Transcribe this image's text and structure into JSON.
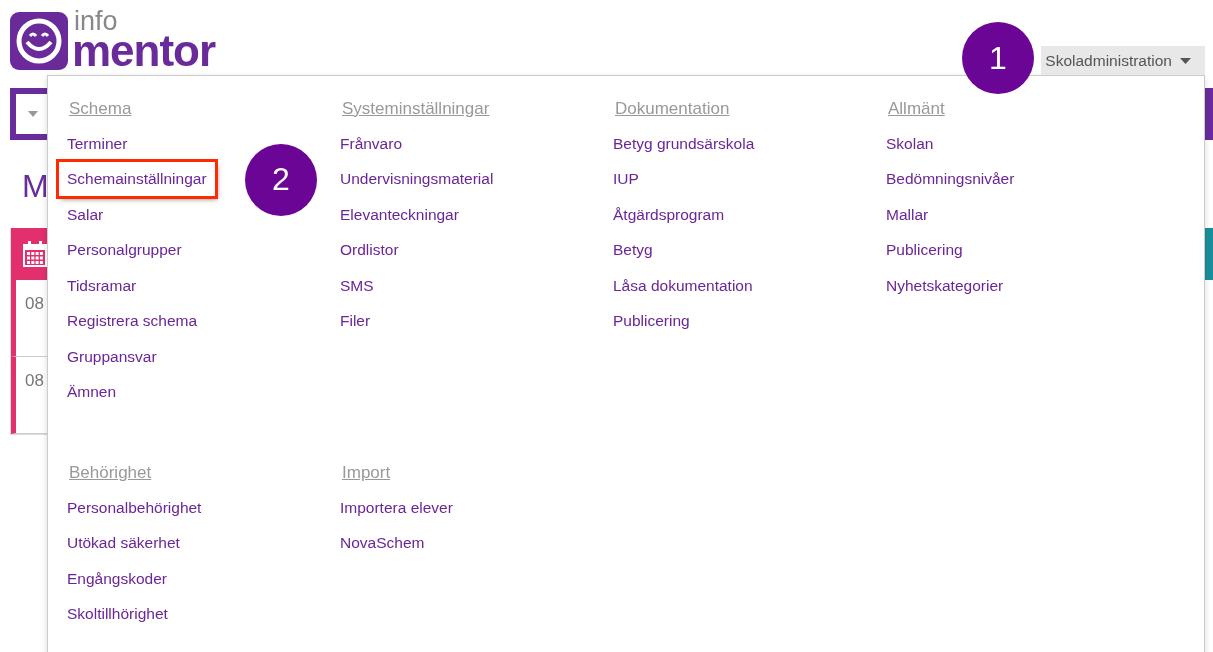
{
  "header": {
    "logo": {
      "top": "info",
      "bottom": "mentor"
    },
    "admin_button": {
      "label": "Skoladministration",
      "open": true
    }
  },
  "background": {
    "heading": "M",
    "times": [
      "08",
      "08"
    ]
  },
  "menu": {
    "sections": [
      {
        "title": "Schema",
        "items": [
          {
            "label": "Terminer",
            "highlighted": false
          },
          {
            "label": "Schemainställningar",
            "highlighted": true
          },
          {
            "label": "Salar",
            "highlighted": false
          },
          {
            "label": "Personalgrupper",
            "highlighted": false
          },
          {
            "label": "Tidsramar",
            "highlighted": false
          },
          {
            "label": "Registrera schema",
            "highlighted": false
          },
          {
            "label": "Gruppansvar",
            "highlighted": false
          },
          {
            "label": "Ämnen",
            "highlighted": false
          }
        ]
      },
      {
        "title": "Systeminställningar",
        "items": [
          {
            "label": "Frånvaro",
            "highlighted": false
          },
          {
            "label": "Undervisningsmaterial",
            "highlighted": false
          },
          {
            "label": "Elevanteckningar",
            "highlighted": false
          },
          {
            "label": "Ordlistor",
            "highlighted": false
          },
          {
            "label": "SMS",
            "highlighted": false
          },
          {
            "label": "Filer",
            "highlighted": false
          }
        ]
      },
      {
        "title": "Dokumentation",
        "items": [
          {
            "label": "Betyg grundsärskola",
            "highlighted": false
          },
          {
            "label": "IUP",
            "highlighted": false
          },
          {
            "label": "Åtgärdsprogram",
            "highlighted": false
          },
          {
            "label": "Betyg",
            "highlighted": false
          },
          {
            "label": "Låsa dokumentation",
            "highlighted": false
          },
          {
            "label": "Publicering",
            "highlighted": false
          }
        ]
      },
      {
        "title": "Allmänt",
        "items": [
          {
            "label": "Skolan",
            "highlighted": false
          },
          {
            "label": "Bedömningsnivåer",
            "highlighted": false
          },
          {
            "label": "Mallar",
            "highlighted": false
          },
          {
            "label": "Publicering",
            "highlighted": false
          },
          {
            "label": "Nyhetskategorier",
            "highlighted": false
          }
        ]
      },
      {
        "title": "Behörighet",
        "items": [
          {
            "label": "Personalbehörighet",
            "highlighted": false
          },
          {
            "label": "Utökad säkerhet",
            "highlighted": false
          },
          {
            "label": "Engångskoder",
            "highlighted": false
          },
          {
            "label": "Skoltillhörighet",
            "highlighted": false
          }
        ]
      },
      {
        "title": "Import",
        "items": [
          {
            "label": "Importera elever",
            "highlighted": false
          },
          {
            "label": "NovaSchem",
            "highlighted": false
          }
        ]
      }
    ]
  },
  "annotations": [
    {
      "number": "1"
    },
    {
      "number": "2"
    }
  ]
}
